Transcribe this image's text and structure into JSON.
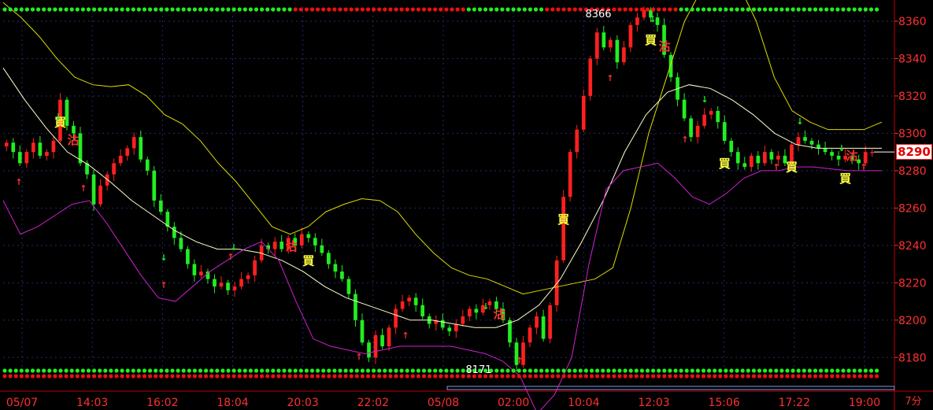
{
  "chart_data": {
    "type": "candlestick",
    "timeframe_label": "7分",
    "ylim": [
      8170,
      8368
    ],
    "y_ticks": [
      8180,
      8200,
      8220,
      8240,
      8260,
      8280,
      8300,
      8320,
      8340,
      8360
    ],
    "x_ticks": [
      "05/07",
      "14:03",
      "16:02",
      "18:04",
      "20:03",
      "22:02",
      "05/08",
      "02:00",
      "10:04",
      "12:03",
      "15:06",
      "17:22",
      "19:00"
    ],
    "current_price": "8290",
    "high_label": "8366",
    "low_label": "8171",
    "signal_texts": {
      "buy": "買",
      "sell": "沽"
    },
    "colors": {
      "up": "#ff2020",
      "down": "#22ee22",
      "upper_band": "#dddd00",
      "mid_band": "#ffffc8",
      "lower_band": "#d020d0",
      "grid": "#1e2a78",
      "axis_text": "#ff3030"
    },
    "close": [
      8295,
      8290,
      8284,
      8290,
      8295,
      8288,
      8290,
      8296,
      8318,
      8304,
      8300,
      8284,
      8278,
      8262,
      8272,
      8278,
      8284,
      8288,
      8292,
      8298,
      8286,
      8280,
      8264,
      8258,
      8250,
      8244,
      8238,
      8230,
      8224,
      8226,
      8222,
      8218,
      8220,
      8216,
      8218,
      8222,
      8224,
      8232,
      8240,
      8238,
      8242,
      8238,
      8244,
      8240,
      8246,
      8244,
      8240,
      8236,
      8230,
      8226,
      8222,
      8214,
      8200,
      8188,
      8180,
      8192,
      8186,
      8196,
      8206,
      8210,
      8212,
      8208,
      8202,
      8198,
      8200,
      8196,
      8194,
      8198,
      8202,
      8206,
      8204,
      8208,
      8210,
      8206,
      8200,
      8188,
      8176,
      8188,
      8196,
      8202,
      8190,
      8208,
      8232,
      8266,
      8290,
      8302,
      8320,
      8340,
      8354,
      8346,
      8350,
      8338,
      8346,
      8358,
      8362,
      8366,
      8362,
      8358,
      8342,
      8330,
      8318,
      8308,
      8298,
      8304,
      8310,
      8312,
      8306,
      8296,
      8290,
      8284,
      8282,
      8288,
      8284,
      8290,
      8286,
      8288,
      8284,
      8294,
      8298,
      8296,
      8294,
      8292,
      8290,
      8288,
      8286,
      8288,
      8286,
      8284,
      8290,
      8290
    ],
    "upper_band": [
      8370,
      8362,
      8352,
      8340,
      8330,
      8326,
      8325,
      8326,
      8320,
      8310,
      8305,
      8296,
      8284,
      8274,
      8262,
      8250,
      8246,
      8250,
      8258,
      8262,
      8265,
      8264,
      8258,
      8246,
      8236,
      8228,
      8224,
      8222,
      8218,
      8214,
      8216,
      8218,
      8220,
      8222,
      8228,
      8260,
      8300,
      8330,
      8360,
      8378,
      8385,
      8380,
      8360,
      8330,
      8312,
      8306,
      8302,
      8302,
      8302,
      8306
    ],
    "mid_band": [
      8335,
      8318,
      8303,
      8290,
      8283,
      8274,
      8264,
      8256,
      8248,
      8242,
      8238,
      8238,
      8236,
      8232,
      8226,
      8218,
      8212,
      8208,
      8204,
      8200,
      8200,
      8198,
      8196,
      8196,
      8200,
      8208,
      8222,
      8242,
      8264,
      8290,
      8310,
      8322,
      8326,
      8324,
      8318,
      8310,
      8300,
      8294,
      8292,
      8292,
      8292,
      8292
    ],
    "lower_band": [
      8264,
      8246,
      8250,
      8256,
      8262,
      8264,
      8252,
      8238,
      8224,
      8212,
      8210,
      8218,
      8226,
      8232,
      8238,
      8242,
      8232,
      8210,
      8190,
      8186,
      8184,
      8182,
      8184,
      8186,
      8186,
      8186,
      8186,
      8184,
      8182,
      8178,
      8170,
      8150,
      8160,
      8180,
      8230,
      8270,
      8280,
      8282,
      8284,
      8276,
      8266,
      8262,
      8268,
      8276,
      8280,
      8280,
      8282,
      8282,
      8281,
      8280,
      8280,
      8280
    ]
  }
}
